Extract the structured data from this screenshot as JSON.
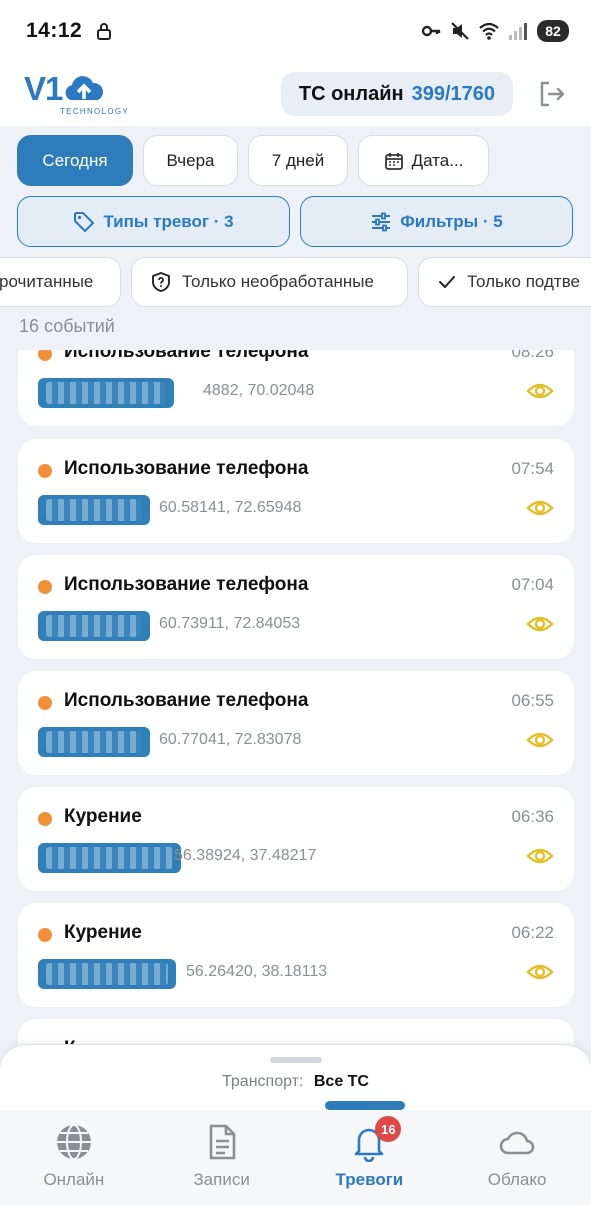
{
  "status_bar": {
    "time": "14:12",
    "battery": "82"
  },
  "header": {
    "logo_text": "V1",
    "logo_sub": "TECHNOLOGY",
    "online_label": "ТС онлайн",
    "online_value": "399/1760"
  },
  "date_chips": [
    "Сегодня",
    "Вчера",
    "7 дней",
    "Дата..."
  ],
  "filter_buttons": {
    "alarm_types": "Типы тревог · 3",
    "filters": "Фильтры · 5"
  },
  "status_filters": [
    "рочитанные",
    "Только необработанные",
    "Только подтве"
  ],
  "events_count": "16 событий",
  "events": [
    {
      "title": "Использование телефона",
      "time": "08:26",
      "coords": "4882, 70.02048"
    },
    {
      "title": "Использование телефона",
      "time": "07:54",
      "coords": "60.58141, 72.65948"
    },
    {
      "title": "Использование телефона",
      "time": "07:04",
      "coords": "60.73911, 72.84053"
    },
    {
      "title": "Использование телефона",
      "time": "06:55",
      "coords": "60.77041, 72.83078"
    },
    {
      "title": "Курение",
      "time": "06:36",
      "coords": "56.38924, 37.48217"
    },
    {
      "title": "Курение",
      "time": "06:22",
      "coords": "56.26420, 38.18113"
    },
    {
      "title": "К",
      "time": "",
      "coords": ""
    }
  ],
  "transport": {
    "label": "Транспорт:",
    "value": "Все ТС"
  },
  "nav": [
    {
      "label": "Онлайн",
      "icon": "globe-icon"
    },
    {
      "label": "Записи",
      "icon": "document-icon"
    },
    {
      "label": "Тревоги",
      "icon": "bell-icon",
      "badge": "16"
    },
    {
      "label": "Облако",
      "icon": "cloud-icon"
    }
  ],
  "colors": {
    "accent": "#2e7dba",
    "event_dot": "#f0913a",
    "eye": "#e3bf2a",
    "badge": "#e04848"
  }
}
